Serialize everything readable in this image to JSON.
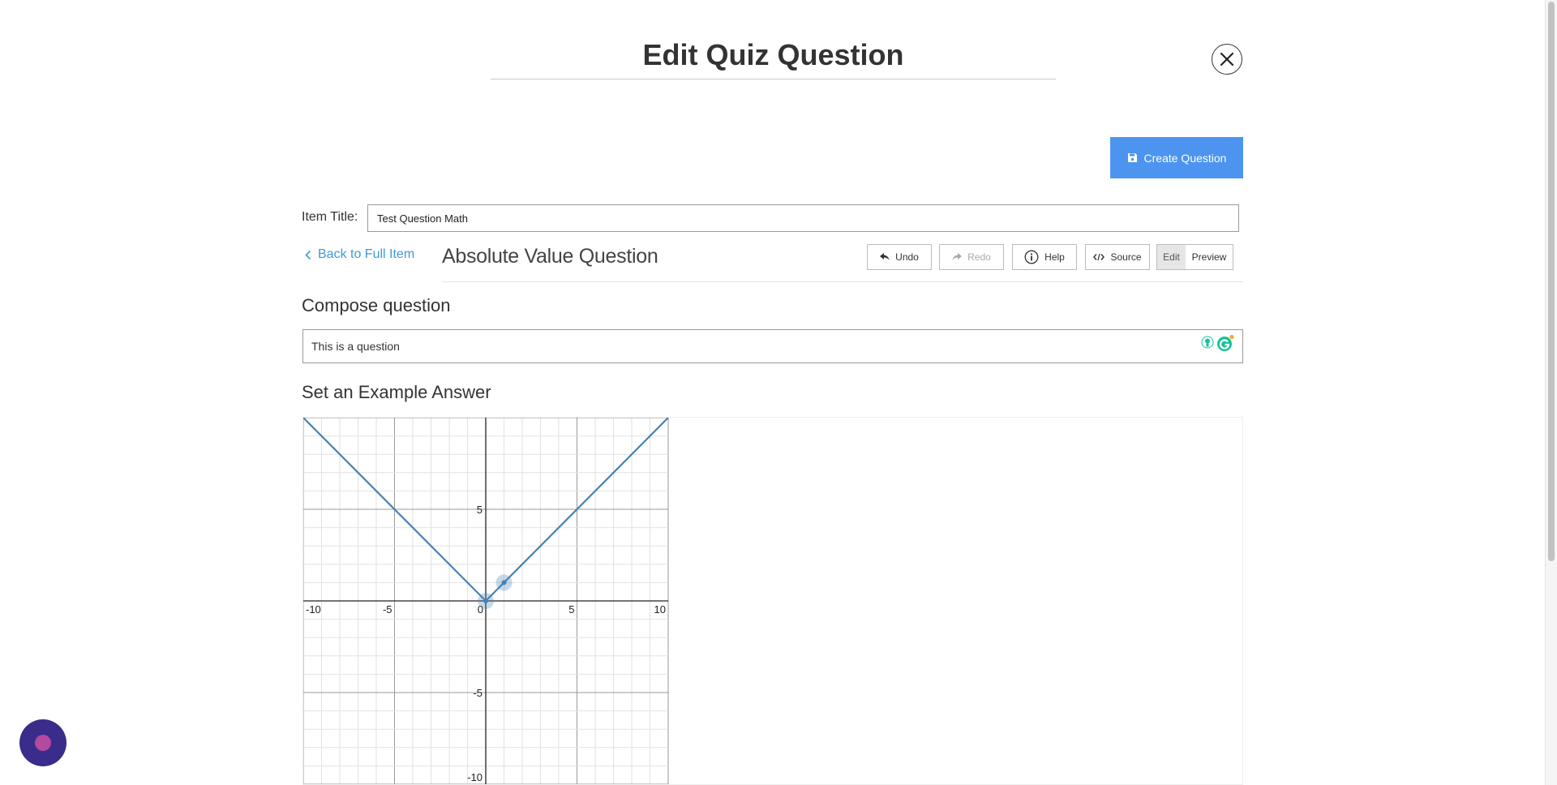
{
  "modal": {
    "title": "Edit Quiz Question",
    "close_icon": "close-icon",
    "create_button_label": "Create Question",
    "create_button_icon": "save-icon",
    "accent_color": "#4d94f0"
  },
  "item": {
    "title_label": "Item Title:",
    "title_value": "Test Question Math"
  },
  "editor": {
    "back_label": "Back to Full Item",
    "question_type": "Absolute Value Question",
    "toolbar": {
      "undo": "Undo",
      "redo": "Redo",
      "help": "Help",
      "source": "Source",
      "edit": "Edit",
      "preview": "Preview"
    },
    "compose_heading": "Compose question",
    "compose_text": "This is a question",
    "example_heading": "Set an Example Answer"
  },
  "chart_data": {
    "type": "line",
    "title": "",
    "xlabel": "",
    "ylabel": "",
    "xlim": [
      -10,
      10
    ],
    "ylim": [
      -10,
      10
    ],
    "grid": true,
    "x_ticks": [
      -10,
      -5,
      0,
      5,
      10
    ],
    "y_ticks": [
      5,
      -5,
      -10
    ],
    "series": [
      {
        "x": [
          -10,
          0,
          10
        ],
        "y": [
          10,
          0,
          10
        ]
      }
    ],
    "points": [
      {
        "x": 0,
        "y": 0
      },
      {
        "x": 1,
        "y": 1
      }
    ],
    "line_color": "#4682b4"
  }
}
